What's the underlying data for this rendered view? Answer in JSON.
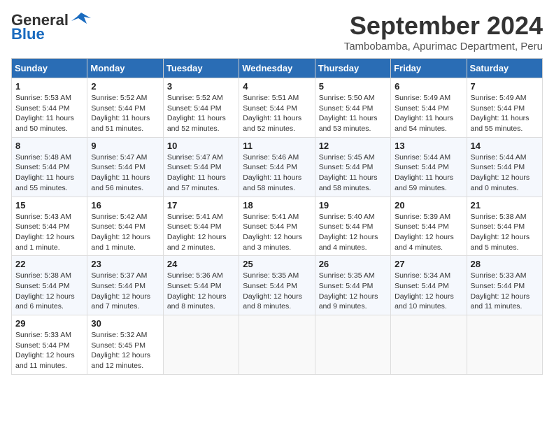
{
  "header": {
    "logo_general": "General",
    "logo_blue": "Blue",
    "month_year": "September 2024",
    "location": "Tambobamba, Apurimac Department, Peru"
  },
  "weekdays": [
    "Sunday",
    "Monday",
    "Tuesday",
    "Wednesday",
    "Thursday",
    "Friday",
    "Saturday"
  ],
  "weeks": [
    [
      {
        "day": "1",
        "sunrise": "5:53 AM",
        "sunset": "5:44 PM",
        "daylight": "11 hours and 50 minutes."
      },
      {
        "day": "2",
        "sunrise": "5:52 AM",
        "sunset": "5:44 PM",
        "daylight": "11 hours and 51 minutes."
      },
      {
        "day": "3",
        "sunrise": "5:52 AM",
        "sunset": "5:44 PM",
        "daylight": "11 hours and 52 minutes."
      },
      {
        "day": "4",
        "sunrise": "5:51 AM",
        "sunset": "5:44 PM",
        "daylight": "11 hours and 52 minutes."
      },
      {
        "day": "5",
        "sunrise": "5:50 AM",
        "sunset": "5:44 PM",
        "daylight": "11 hours and 53 minutes."
      },
      {
        "day": "6",
        "sunrise": "5:49 AM",
        "sunset": "5:44 PM",
        "daylight": "11 hours and 54 minutes."
      },
      {
        "day": "7",
        "sunrise": "5:49 AM",
        "sunset": "5:44 PM",
        "daylight": "11 hours and 55 minutes."
      }
    ],
    [
      {
        "day": "8",
        "sunrise": "5:48 AM",
        "sunset": "5:44 PM",
        "daylight": "11 hours and 55 minutes."
      },
      {
        "day": "9",
        "sunrise": "5:47 AM",
        "sunset": "5:44 PM",
        "daylight": "11 hours and 56 minutes."
      },
      {
        "day": "10",
        "sunrise": "5:47 AM",
        "sunset": "5:44 PM",
        "daylight": "11 hours and 57 minutes."
      },
      {
        "day": "11",
        "sunrise": "5:46 AM",
        "sunset": "5:44 PM",
        "daylight": "11 hours and 58 minutes."
      },
      {
        "day": "12",
        "sunrise": "5:45 AM",
        "sunset": "5:44 PM",
        "daylight": "11 hours and 58 minutes."
      },
      {
        "day": "13",
        "sunrise": "5:44 AM",
        "sunset": "5:44 PM",
        "daylight": "11 hours and 59 minutes."
      },
      {
        "day": "14",
        "sunrise": "5:44 AM",
        "sunset": "5:44 PM",
        "daylight": "12 hours and 0 minutes."
      }
    ],
    [
      {
        "day": "15",
        "sunrise": "5:43 AM",
        "sunset": "5:44 PM",
        "daylight": "12 hours and 1 minute."
      },
      {
        "day": "16",
        "sunrise": "5:42 AM",
        "sunset": "5:44 PM",
        "daylight": "12 hours and 1 minute."
      },
      {
        "day": "17",
        "sunrise": "5:41 AM",
        "sunset": "5:44 PM",
        "daylight": "12 hours and 2 minutes."
      },
      {
        "day": "18",
        "sunrise": "5:41 AM",
        "sunset": "5:44 PM",
        "daylight": "12 hours and 3 minutes."
      },
      {
        "day": "19",
        "sunrise": "5:40 AM",
        "sunset": "5:44 PM",
        "daylight": "12 hours and 4 minutes."
      },
      {
        "day": "20",
        "sunrise": "5:39 AM",
        "sunset": "5:44 PM",
        "daylight": "12 hours and 4 minutes."
      },
      {
        "day": "21",
        "sunrise": "5:38 AM",
        "sunset": "5:44 PM",
        "daylight": "12 hours and 5 minutes."
      }
    ],
    [
      {
        "day": "22",
        "sunrise": "5:38 AM",
        "sunset": "5:44 PM",
        "daylight": "12 hours and 6 minutes."
      },
      {
        "day": "23",
        "sunrise": "5:37 AM",
        "sunset": "5:44 PM",
        "daylight": "12 hours and 7 minutes."
      },
      {
        "day": "24",
        "sunrise": "5:36 AM",
        "sunset": "5:44 PM",
        "daylight": "12 hours and 8 minutes."
      },
      {
        "day": "25",
        "sunrise": "5:35 AM",
        "sunset": "5:44 PM",
        "daylight": "12 hours and 8 minutes."
      },
      {
        "day": "26",
        "sunrise": "5:35 AM",
        "sunset": "5:44 PM",
        "daylight": "12 hours and 9 minutes."
      },
      {
        "day": "27",
        "sunrise": "5:34 AM",
        "sunset": "5:44 PM",
        "daylight": "12 hours and 10 minutes."
      },
      {
        "day": "28",
        "sunrise": "5:33 AM",
        "sunset": "5:44 PM",
        "daylight": "12 hours and 11 minutes."
      }
    ],
    [
      {
        "day": "29",
        "sunrise": "5:33 AM",
        "sunset": "5:44 PM",
        "daylight": "12 hours and 11 minutes."
      },
      {
        "day": "30",
        "sunrise": "5:32 AM",
        "sunset": "5:45 PM",
        "daylight": "12 hours and 12 minutes."
      },
      null,
      null,
      null,
      null,
      null
    ]
  ]
}
